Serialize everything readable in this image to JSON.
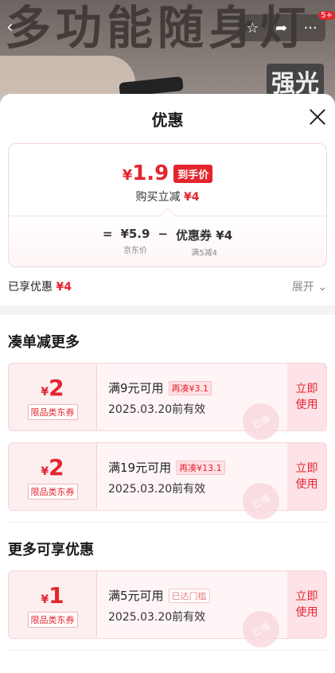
{
  "banner": {
    "headline": "多功能随身灯",
    "tag": "强光",
    "badge": "5+"
  },
  "sheet": {
    "title": "优惠"
  },
  "price_card": {
    "final_price_symbol": "¥",
    "final_price": "1.9",
    "final_tag": "到手价",
    "instant_label": "购买立减",
    "instant_value": "¥4",
    "equals": "=",
    "jd_price": "¥5.9",
    "jd_price_label": "京东价",
    "minus": "−",
    "coupon_text": "优惠券 ¥4",
    "coupon_rule": "满5减4"
  },
  "enjoy": {
    "label": "已享优惠",
    "value": "¥4",
    "expand_label": "展开"
  },
  "section1": {
    "title": "凑单减更多",
    "coupons": [
      {
        "symbol": "¥",
        "amount": "2",
        "type": "限品类东券",
        "condition": "满9元可用",
        "hint": "再凑¥3.1",
        "date": "2025.03.20前有效",
        "action": "立即使用",
        "stamp": "已领"
      },
      {
        "symbol": "¥",
        "amount": "2",
        "type": "限品类东券",
        "condition": "满19元可用",
        "hint": "再凑¥13.1",
        "date": "2025.03.20前有效",
        "action": "立即使用",
        "stamp": "已领"
      }
    ]
  },
  "section2": {
    "title": "更多可享优惠",
    "coupons": [
      {
        "symbol": "¥",
        "amount": "1",
        "type": "限品类东券",
        "condition": "满5元可用",
        "hint": "已达门槛",
        "date": "2025.03.20前有效",
        "action": "立即使用",
        "stamp": "已领"
      }
    ]
  },
  "colors": {
    "accent": "#e4252d",
    "coupon_bg": "#fdeef0"
  }
}
